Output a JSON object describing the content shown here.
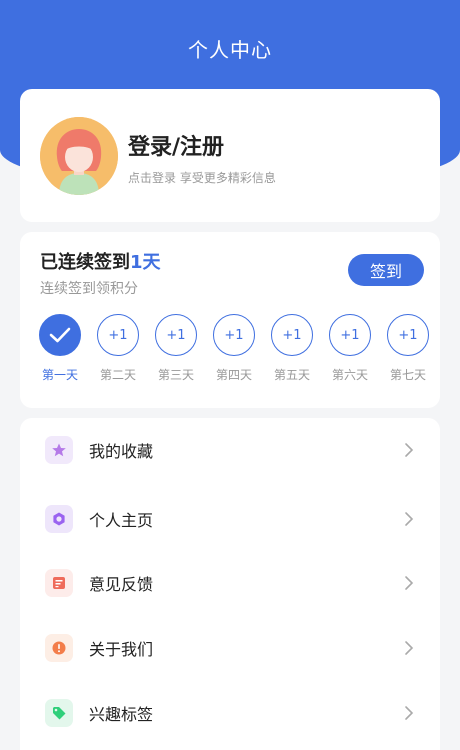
{
  "header": {
    "title": "个人中心"
  },
  "profile": {
    "name": "登录/注册",
    "subtitle": "点击登录 享受更多精彩信息"
  },
  "checkin": {
    "title_prefix": "已连续签到",
    "days_count": "1天",
    "subtitle": "连续签到领积分",
    "button_label": "签到",
    "days": [
      {
        "label": "第一天",
        "badge": "",
        "done": true
      },
      {
        "label": "第二天",
        "badge": "+1",
        "done": false
      },
      {
        "label": "第三天",
        "badge": "+1",
        "done": false
      },
      {
        "label": "第四天",
        "badge": "+1",
        "done": false
      },
      {
        "label": "第五天",
        "badge": "+1",
        "done": false
      },
      {
        "label": "第六天",
        "badge": "+1",
        "done": false
      },
      {
        "label": "第七天",
        "badge": "+1",
        "done": false
      }
    ]
  },
  "menu": {
    "items": [
      {
        "label": "我的收藏",
        "icon": "star-icon"
      },
      {
        "label": "个人主页",
        "icon": "hexagon-icon"
      },
      {
        "label": "意见反馈",
        "icon": "feedback-icon"
      },
      {
        "label": "关于我们",
        "icon": "info-icon"
      },
      {
        "label": "兴趣标签",
        "icon": "tag-icon"
      }
    ]
  },
  "colors": {
    "primary": "#3f6fe0",
    "star_bg": "#f1e9fb",
    "star_fg": "#b57ae8",
    "hexagon_bg": "#eee6fb",
    "hexagon_fg": "#9a63f0",
    "feedback_bg": "#fdecea",
    "feedback_fg": "#ef6b5b",
    "info_bg": "#fdeee5",
    "info_fg": "#f37d4a",
    "tag_bg": "#e3f7ec",
    "tag_fg": "#2fcf7a"
  }
}
